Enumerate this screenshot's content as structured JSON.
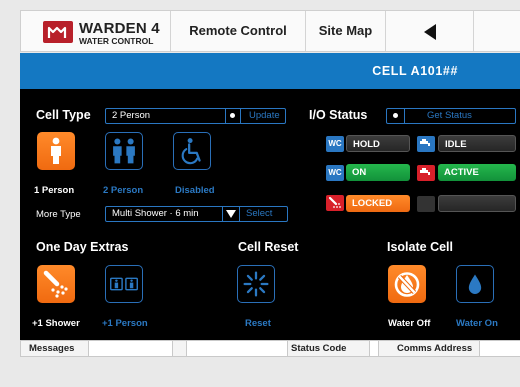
{
  "header": {
    "logo_title": "WARDEN 4",
    "logo_subtitle": "WATER CONTROL",
    "nav": [
      "Remote Control",
      "Site Map"
    ],
    "back_icon": "back-arrow-icon"
  },
  "cell_bar": {
    "title": "CELL A101##"
  },
  "cell_type": {
    "label": "Cell Type",
    "selected": "2 Person",
    "update_label": "Update",
    "options": [
      {
        "label": "1 Person",
        "icon": "single-person-icon",
        "state": "selected"
      },
      {
        "label": "2 Person",
        "icon": "two-person-icon",
        "state": "normal"
      },
      {
        "label": "Disabled",
        "icon": "wheelchair-icon",
        "state": "normal"
      }
    ],
    "more_type_label": "More Type",
    "more_type_selected": "Multi Shower · 6 min",
    "select_label": "Select"
  },
  "io_status": {
    "label": "I/O Status",
    "get_status_label": "Get Status",
    "rows": [
      {
        "left_tag": "WC",
        "left_text": "HOLD",
        "right_icon": "tap-icon",
        "right_text": "IDLE"
      },
      {
        "left_tag": "WC",
        "left_text": "ON",
        "right_icon": "tap-icon",
        "right_text": "ACTIVE"
      },
      {
        "left_tag": "shower-icon",
        "left_text": "LOCKED",
        "right_icon": "",
        "right_text": ""
      }
    ],
    "colors": {
      "on": "#1a9e3e",
      "locked": "#f07a1e",
      "active_icon": "#d8202a",
      "blue": "#2a77c2"
    }
  },
  "one_day_extras": {
    "label": "One Day Extras",
    "items": [
      {
        "label": "+1 Shower",
        "icon": "shower-icon",
        "state": "selected"
      },
      {
        "label": "+1 Person",
        "icon": "two-person-icon",
        "state": "normal"
      }
    ]
  },
  "cell_reset": {
    "label": "Cell Reset",
    "button_label": "Reset",
    "icon": "reset-spinner-icon"
  },
  "isolate_cell": {
    "label": "Isolate Cell",
    "items": [
      {
        "label": "Water Off",
        "icon": "water-off-icon",
        "state": "selected"
      },
      {
        "label": "Water On",
        "icon": "water-drop-icon",
        "state": "normal"
      }
    ]
  },
  "status_bar": {
    "messages_label": "Messages",
    "status_code_label": "Status Code",
    "comms_address_label": "Comms Address"
  },
  "theme": {
    "accent": "#1478c2",
    "orange": "#f47a20",
    "panel_bg": "#000000"
  }
}
